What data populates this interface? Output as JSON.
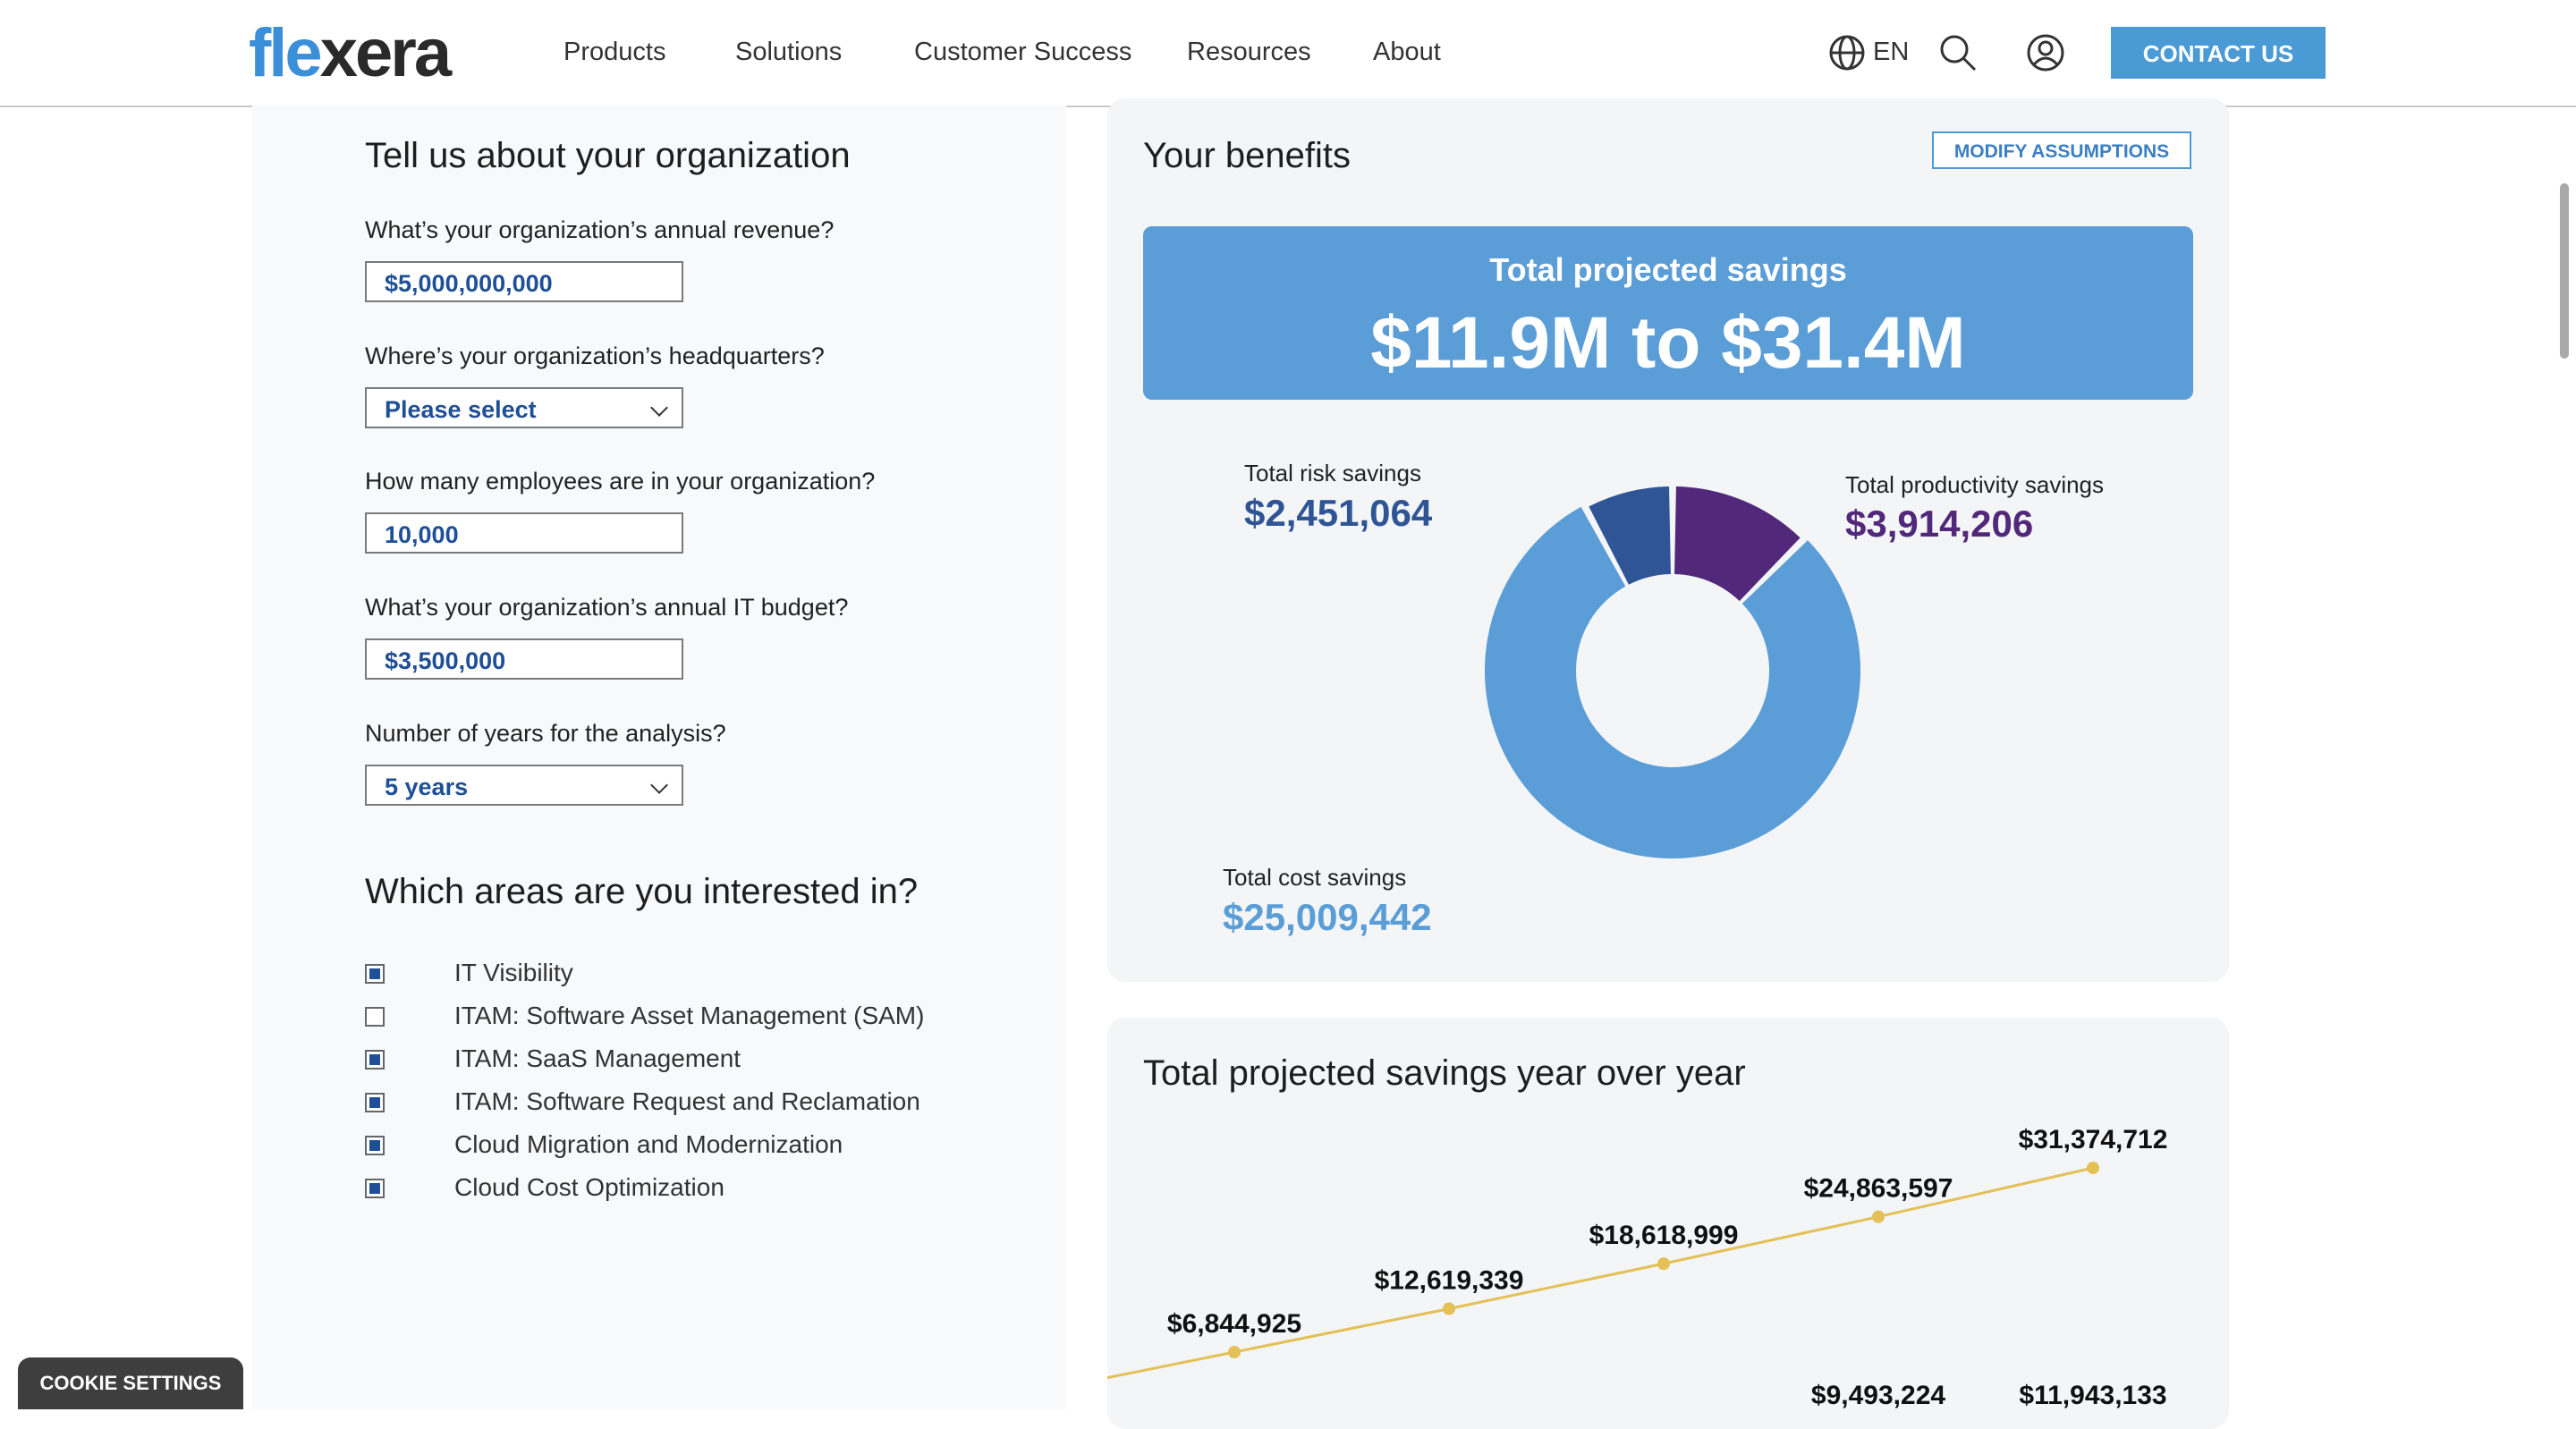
{
  "header": {
    "logo": {
      "part1": "fle",
      "part2": "xera",
      "mark": "."
    },
    "nav": [
      "Products",
      "Solutions",
      "Customer Success",
      "Resources",
      "About"
    ],
    "language": "EN",
    "icons": [
      "globe-icon",
      "search-icon",
      "user-icon"
    ],
    "contact_label": "CONTACT US"
  },
  "form": {
    "title": "Tell us about your organization",
    "revenue": {
      "question": "What’s your organization’s annual revenue?",
      "value": "$5,000,000,000"
    },
    "hq": {
      "question": "Where’s your organization’s headquarters?",
      "value": "Please select"
    },
    "employees": {
      "question": "How many employees are in your organization?",
      "value": "10,000"
    },
    "it_budget": {
      "question": "What’s your organization’s annual IT budget?",
      "value": "$3,500,000"
    },
    "years": {
      "question": "Number of years for the analysis?",
      "value": "5 years"
    }
  },
  "areas": {
    "title": "Which areas are you interested in?",
    "items": [
      {
        "label": "IT Visibility",
        "checked": true
      },
      {
        "label": "ITAM: Software Asset Management (SAM)",
        "checked": false
      },
      {
        "label": "ITAM: SaaS Management",
        "checked": true
      },
      {
        "label": "ITAM: Software Request and Reclamation",
        "checked": true
      },
      {
        "label": "Cloud Migration and Modernization",
        "checked": true
      },
      {
        "label": "Cloud Cost Optimization",
        "checked": true
      }
    ]
  },
  "benefits": {
    "title": "Your benefits",
    "modify_label": "MODIFY ASSUMPTIONS",
    "banner_label": "Total projected savings",
    "banner_value": "$11.9M to $31.4M",
    "risk": {
      "label": "Total risk savings",
      "value": "$2,451,064",
      "color": "#2f5596"
    },
    "productivity": {
      "label": "Total productivity savings",
      "value": "$3,914,206",
      "color": "#52287a"
    },
    "cost": {
      "label": "Total cost savings",
      "value": "$25,009,442",
      "color": "#5b9dd7"
    }
  },
  "yoy": {
    "title": "Total projected savings year over year"
  },
  "chart_data": [
    {
      "type": "pie",
      "donut": true,
      "categories": [
        "Total productivity savings",
        "Total cost savings",
        "Total risk savings"
      ],
      "values": [
        3914206,
        25009442,
        2451064
      ],
      "colors": [
        "#52287a",
        "#5b9dd7",
        "#2f5596"
      ]
    },
    {
      "type": "line",
      "title": "Total projected savings year over year",
      "x": [
        1,
        2,
        3,
        4,
        5
      ],
      "series": [
        {
          "values": [
            6844925,
            12619339,
            18618999,
            24863597,
            31374712
          ],
          "labels": [
            "$6,844,925",
            "$12,619,339",
            "$18,618,999",
            "$24,863,597",
            "$31,374,712"
          ],
          "color": "#e4c056"
        },
        {
          "values": [
            null,
            null,
            null,
            9493224,
            11943133
          ],
          "labels": [
            "",
            "",
            "",
            "$9,493,224",
            "$11,943,133"
          ],
          "color": "#222222"
        }
      ]
    }
  ],
  "cookie_label": "COOKIE SETTINGS"
}
